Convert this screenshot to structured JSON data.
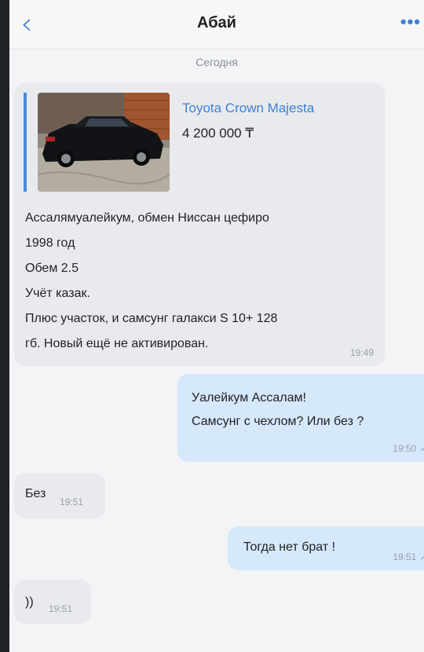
{
  "header": {
    "back_icon": "chevron-left-icon",
    "title": "Абай",
    "more_label": "•••"
  },
  "date_separator": "Сегодня",
  "messages": [
    {
      "direction": "incoming",
      "attachment": {
        "image": "black-sedan-photo",
        "title": "Toyota Crown Majesta",
        "price": "4 200 000 ₸"
      },
      "lines": [
        "Ассалямуалейкум, обмен Ниссан цефиро",
        "1998 год",
        "Обем 2.5",
        "Учёт казак.",
        "Плюс участок, и самсунг галакси S 10+ 128",
        "гб. Новый ещё не активирован."
      ],
      "time": "19:49"
    },
    {
      "direction": "outgoing",
      "lines": [
        "Уалейкум Ассалам!",
        "Самсунг с чехлом? Или без ?"
      ],
      "time": "19:50"
    },
    {
      "direction": "incoming",
      "text": "Без",
      "time": "19:51"
    },
    {
      "direction": "outgoing",
      "text": "Тогда нет брат !",
      "time": "19:51"
    },
    {
      "direction": "incoming",
      "text": "))",
      "time": "19:51"
    }
  ],
  "colors": {
    "accent": "#3e7fd6",
    "incoming_bubble": "#e9eaee",
    "outgoing_bubble": "#d6e8fb"
  }
}
